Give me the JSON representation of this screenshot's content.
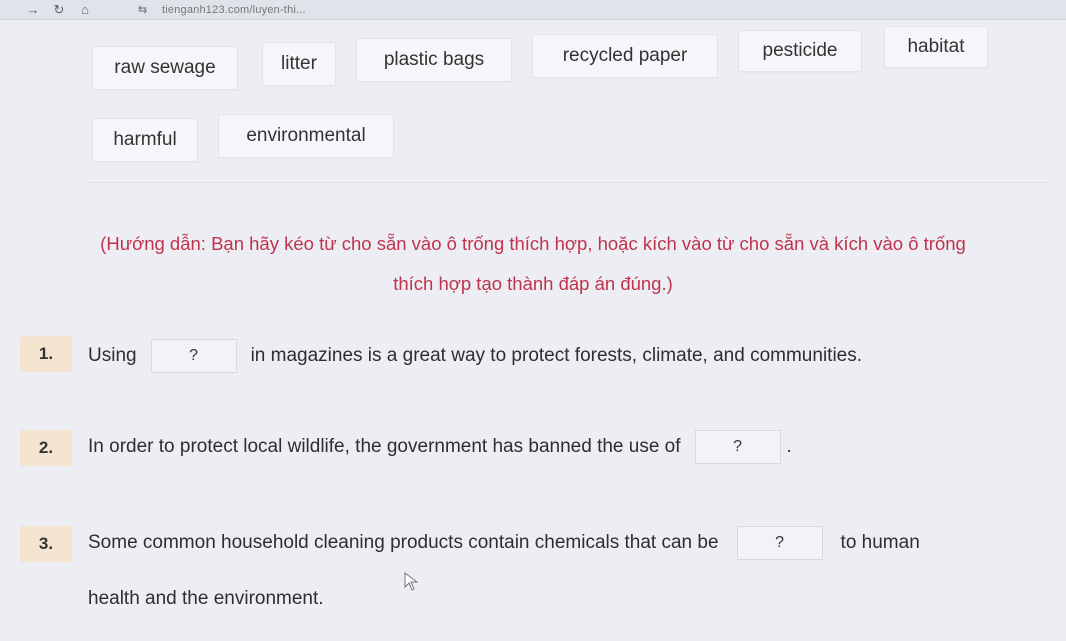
{
  "browser": {
    "url": "tienganh123.com/luyen-thi...",
    "back_glyph": "→",
    "reload_glyph": "↻",
    "home_glyph": "⌂",
    "site_glyph": "⇆"
  },
  "word_bank": [
    "raw sewage",
    "litter",
    "plastic bags",
    "recycled paper",
    "pesticide",
    "habitat",
    "harmful",
    "environmental"
  ],
  "instructions": {
    "line1": "(Hướng dẫn: Bạn hãy kéo từ cho sẵn vào ô trống thích hợp, hoặc kích vào từ cho sẵn và kích vào ô trống",
    "line2": "thích hợp tạo thành đáp án đúng.)"
  },
  "questions": [
    {
      "number": "1.",
      "before": "Using",
      "blank": "?",
      "after": "in magazines is a great way to protect forests, climate, and communities."
    },
    {
      "number": "2.",
      "before": "In order to protect local wildlife, the government has banned the use of",
      "blank": "?",
      "after": "."
    },
    {
      "number": "3.",
      "before": "Some common household cleaning products contain chemicals that can be",
      "blank": "?",
      "after": "to human",
      "line2": "health and the environment."
    }
  ]
}
